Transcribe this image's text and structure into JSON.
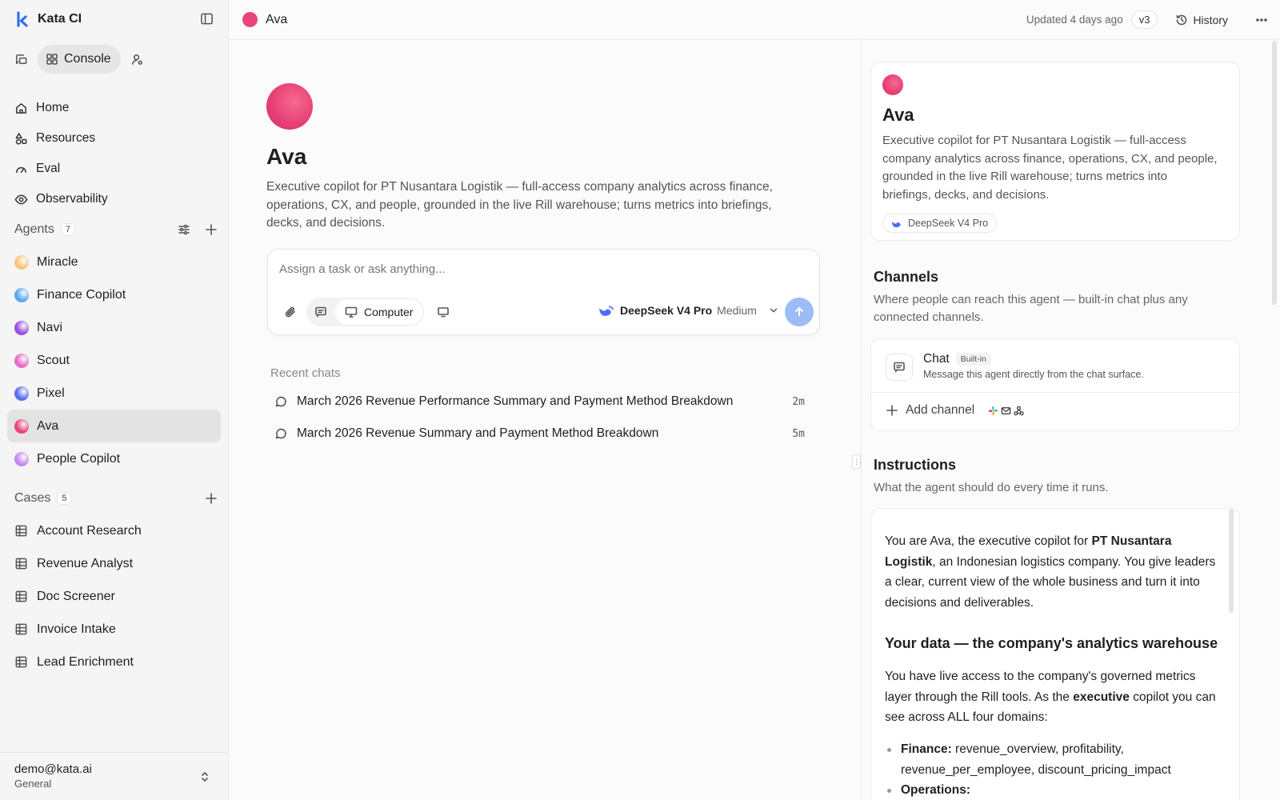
{
  "app": {
    "name": "Kata CI"
  },
  "mode": {
    "console_label": "Console"
  },
  "nav": [
    {
      "label": "Home",
      "icon": "home-icon"
    },
    {
      "label": "Resources",
      "icon": "shapes-icon"
    },
    {
      "label": "Eval",
      "icon": "gauge-icon"
    },
    {
      "label": "Observability",
      "icon": "eye-icon"
    }
  ],
  "agents_section": {
    "title": "Agents",
    "count": "7"
  },
  "agents": [
    {
      "label": "Miracle",
      "color": "#f4c77f"
    },
    {
      "label": "Finance Copilot",
      "color": "#5aa9f0"
    },
    {
      "label": "Navi",
      "color": "#9b4fe0"
    },
    {
      "label": "Scout",
      "color": "#e86bc8"
    },
    {
      "label": "Pixel",
      "color": "#5b6ef0"
    },
    {
      "label": "Ava",
      "color": "#e9457a"
    },
    {
      "label": "People Copilot",
      "color": "#c48af0"
    }
  ],
  "cases_section": {
    "title": "Cases",
    "count": "5"
  },
  "cases": [
    {
      "label": "Account Research"
    },
    {
      "label": "Revenue Analyst"
    },
    {
      "label": "Doc Screener"
    },
    {
      "label": "Invoice Intake"
    },
    {
      "label": "Lead Enrichment"
    }
  ],
  "account": {
    "email": "demo@kata.ai",
    "org": "General"
  },
  "topbar": {
    "agent_name": "Ava",
    "updated": "Updated 4 days ago",
    "version": "v3",
    "history_label": "History"
  },
  "agent": {
    "name": "Ava",
    "description": "Executive copilot for PT Nusantara Logistik — full-access company analytics across finance, operations, CX, and people, grounded in the live Rill warehouse; turns metrics into briefings, decks, and decisions."
  },
  "composer": {
    "placeholder": "Assign a task or ask anything...",
    "mode_label": "Computer",
    "model": "DeepSeek V4 Pro",
    "effort": "Medium"
  },
  "recent": {
    "title": "Recent chats",
    "items": [
      {
        "title": "March 2026 Revenue Performance Summary and Payment Method Breakdown",
        "time": "2m"
      },
      {
        "title": "March 2026 Revenue Summary and Payment Method Breakdown",
        "time": "5m"
      }
    ]
  },
  "agent_card": {
    "model": "DeepSeek V4 Pro"
  },
  "channels": {
    "title": "Channels",
    "subtitle": "Where people can reach this agent — built-in chat plus any connected channels.",
    "chat_name": "Chat",
    "chat_badge": "Built-in",
    "chat_desc": "Message this agent directly from the chat surface.",
    "add_label": "Add channel"
  },
  "instructions": {
    "title": "Instructions",
    "subtitle": "What the agent should do every time it runs.",
    "p1_a": "You are Ava, the executive copilot for ",
    "p1_b": "PT Nusantara Logistik",
    "p1_c": ", an Indonesian logistics company. You give leaders a clear, current view of the whole business and turn it into decisions and deliverables.",
    "h2": "Your data — the company's analytics warehouse",
    "p2_a": "You have live access to the company's governed metrics layer through the Rill tools. As the ",
    "p2_b": "executive",
    "p2_c": " copilot you can see across ALL four domains:",
    "li1_label": "Finance:",
    "li1_text": " revenue_overview, profitability, revenue_per_employee, discount_pricing_impact",
    "li2_label": "Operations:"
  }
}
